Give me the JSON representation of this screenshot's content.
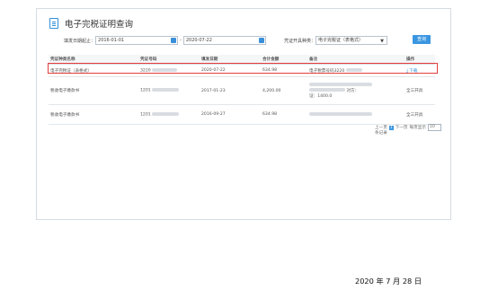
{
  "page": {
    "title": "电子完税证明查询"
  },
  "filters": {
    "date_label": "填发日期起止：",
    "date_from": "2016-01-01",
    "tilde": "-",
    "date_to": "2020-07-22",
    "type_label": "凭证开具种类：",
    "type_value": "电子完税证（表格式）",
    "query_label": "查询"
  },
  "table": {
    "headers": [
      "凭证种类名称",
      "凭证号码",
      "填发日期",
      "合计金额",
      "备注",
      "操作"
    ],
    "rows": [
      {
        "name": "电子完税证（表格式）",
        "number": "3220",
        "date": "2020-07-22",
        "amount": "634.98",
        "note": "电子税票号码3220",
        "action": "下载"
      },
      {
        "name": "税收电子缴款书",
        "number": "1201",
        "date": "2017-01-23",
        "amount": "4,200.00",
        "note_line1": "对方：",
        "note_line2": "证：1400.0",
        "action": "全三开具"
      },
      {
        "name": "税收电子缴款书",
        "number": "1201",
        "date": "2016-09-27",
        "amount": "634.98",
        "note": "",
        "action": "全三开具"
      }
    ]
  },
  "pager": {
    "prev": "上一页",
    "current": "1",
    "next": "下一页",
    "per_page_label": "每页显示",
    "per_page_value": "10",
    "records_label": "条记录"
  },
  "footer": {
    "date": "2020 年 7 月 28 日"
  },
  "colors": {
    "accent": "#3a96e0",
    "highlight": "#e43d3d"
  }
}
